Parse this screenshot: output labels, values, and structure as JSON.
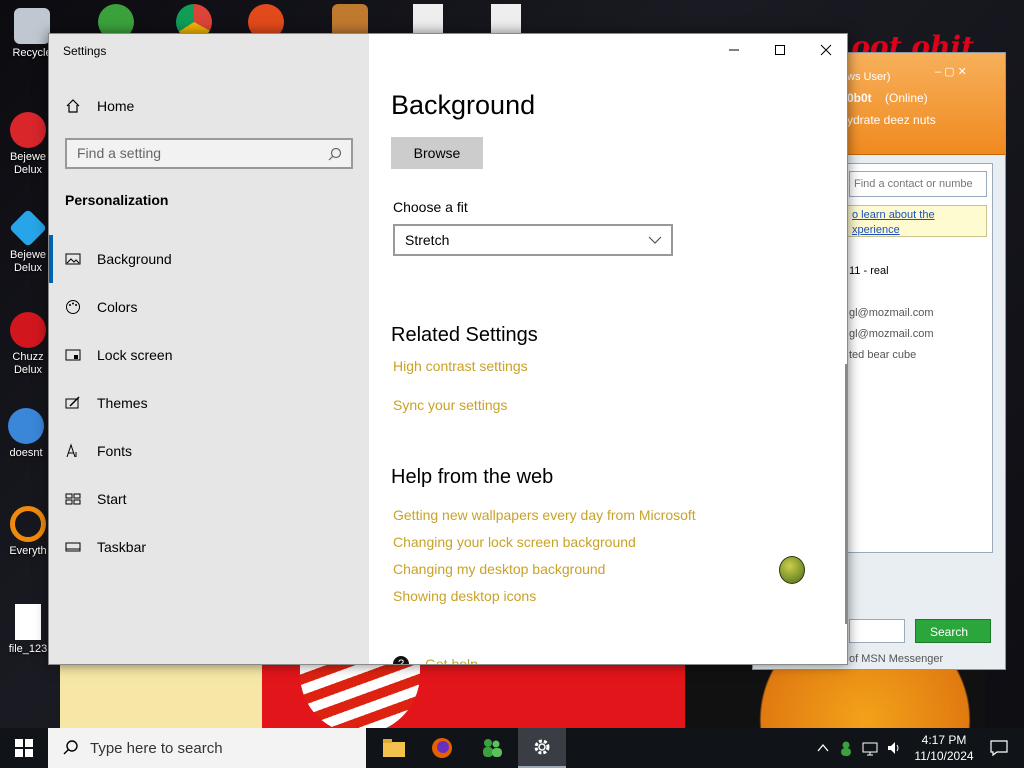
{
  "desktop": {
    "wallpaper_text": "e oot ohit",
    "icons": [
      {
        "label": "Recycle",
        "color": "#bfc7d0"
      },
      {
        "label": "Bejewe Delux",
        "color": "#d8262b"
      },
      {
        "label": "Bejewe Delux",
        "color": "#27a5e8"
      },
      {
        "label": "Chuzz Delux",
        "color": "#d2161d"
      },
      {
        "label": "doesnt",
        "color": "#3a86d9"
      },
      {
        "label": "Everyth",
        "color": "#f08a0c"
      },
      {
        "label": "file_123",
        "color": "#ffffff"
      }
    ]
  },
  "msn": {
    "header": {
      "users": "ws User)",
      "name": "0b0t",
      "status": "(Online)",
      "message": "ydrate deez nuts"
    },
    "find_placeholder": "Find a contact or numbe",
    "tip": "o learn about the xperience",
    "contacts": [
      "11 - real",
      "gl@mozmail.com",
      "gl@mozmail.com",
      "ted bear cube"
    ],
    "search_label": "Search",
    "footer": "of MSN Messenger"
  },
  "settings": {
    "window_title": "Settings",
    "home_label": "Home",
    "search_placeholder": "Find a setting",
    "category": "Personalization",
    "nav": [
      {
        "label": "Background",
        "icon": "image-icon"
      },
      {
        "label": "Colors",
        "icon": "palette-icon"
      },
      {
        "label": "Lock screen",
        "icon": "lock-screen-icon"
      },
      {
        "label": "Themes",
        "icon": "brush-icon"
      },
      {
        "label": "Fonts",
        "icon": "font-icon"
      },
      {
        "label": "Start",
        "icon": "start-grid-icon"
      },
      {
        "label": "Taskbar",
        "icon": "taskbar-icon"
      }
    ],
    "page_title": "Background",
    "browse_label": "Browse",
    "fit_label": "Choose a fit",
    "fit_value": "Stretch",
    "related_heading": "Related Settings",
    "related_links": [
      "High contrast settings",
      "Sync your settings"
    ],
    "help_heading": "Help from the web",
    "help_links": [
      "Getting new wallpapers every day from Microsoft",
      "Changing your lock screen background",
      "Changing my desktop background",
      "Showing desktop icons"
    ],
    "get_help": "Get help",
    "link_color": "#c9a227"
  },
  "taskbar": {
    "search_placeholder": "Type here to search",
    "time": "4:17 PM",
    "date": "11/10/2024",
    "apps": [
      "file-explorer-icon",
      "firefox-icon",
      "msn-messenger-icon",
      "settings-icon"
    ]
  }
}
